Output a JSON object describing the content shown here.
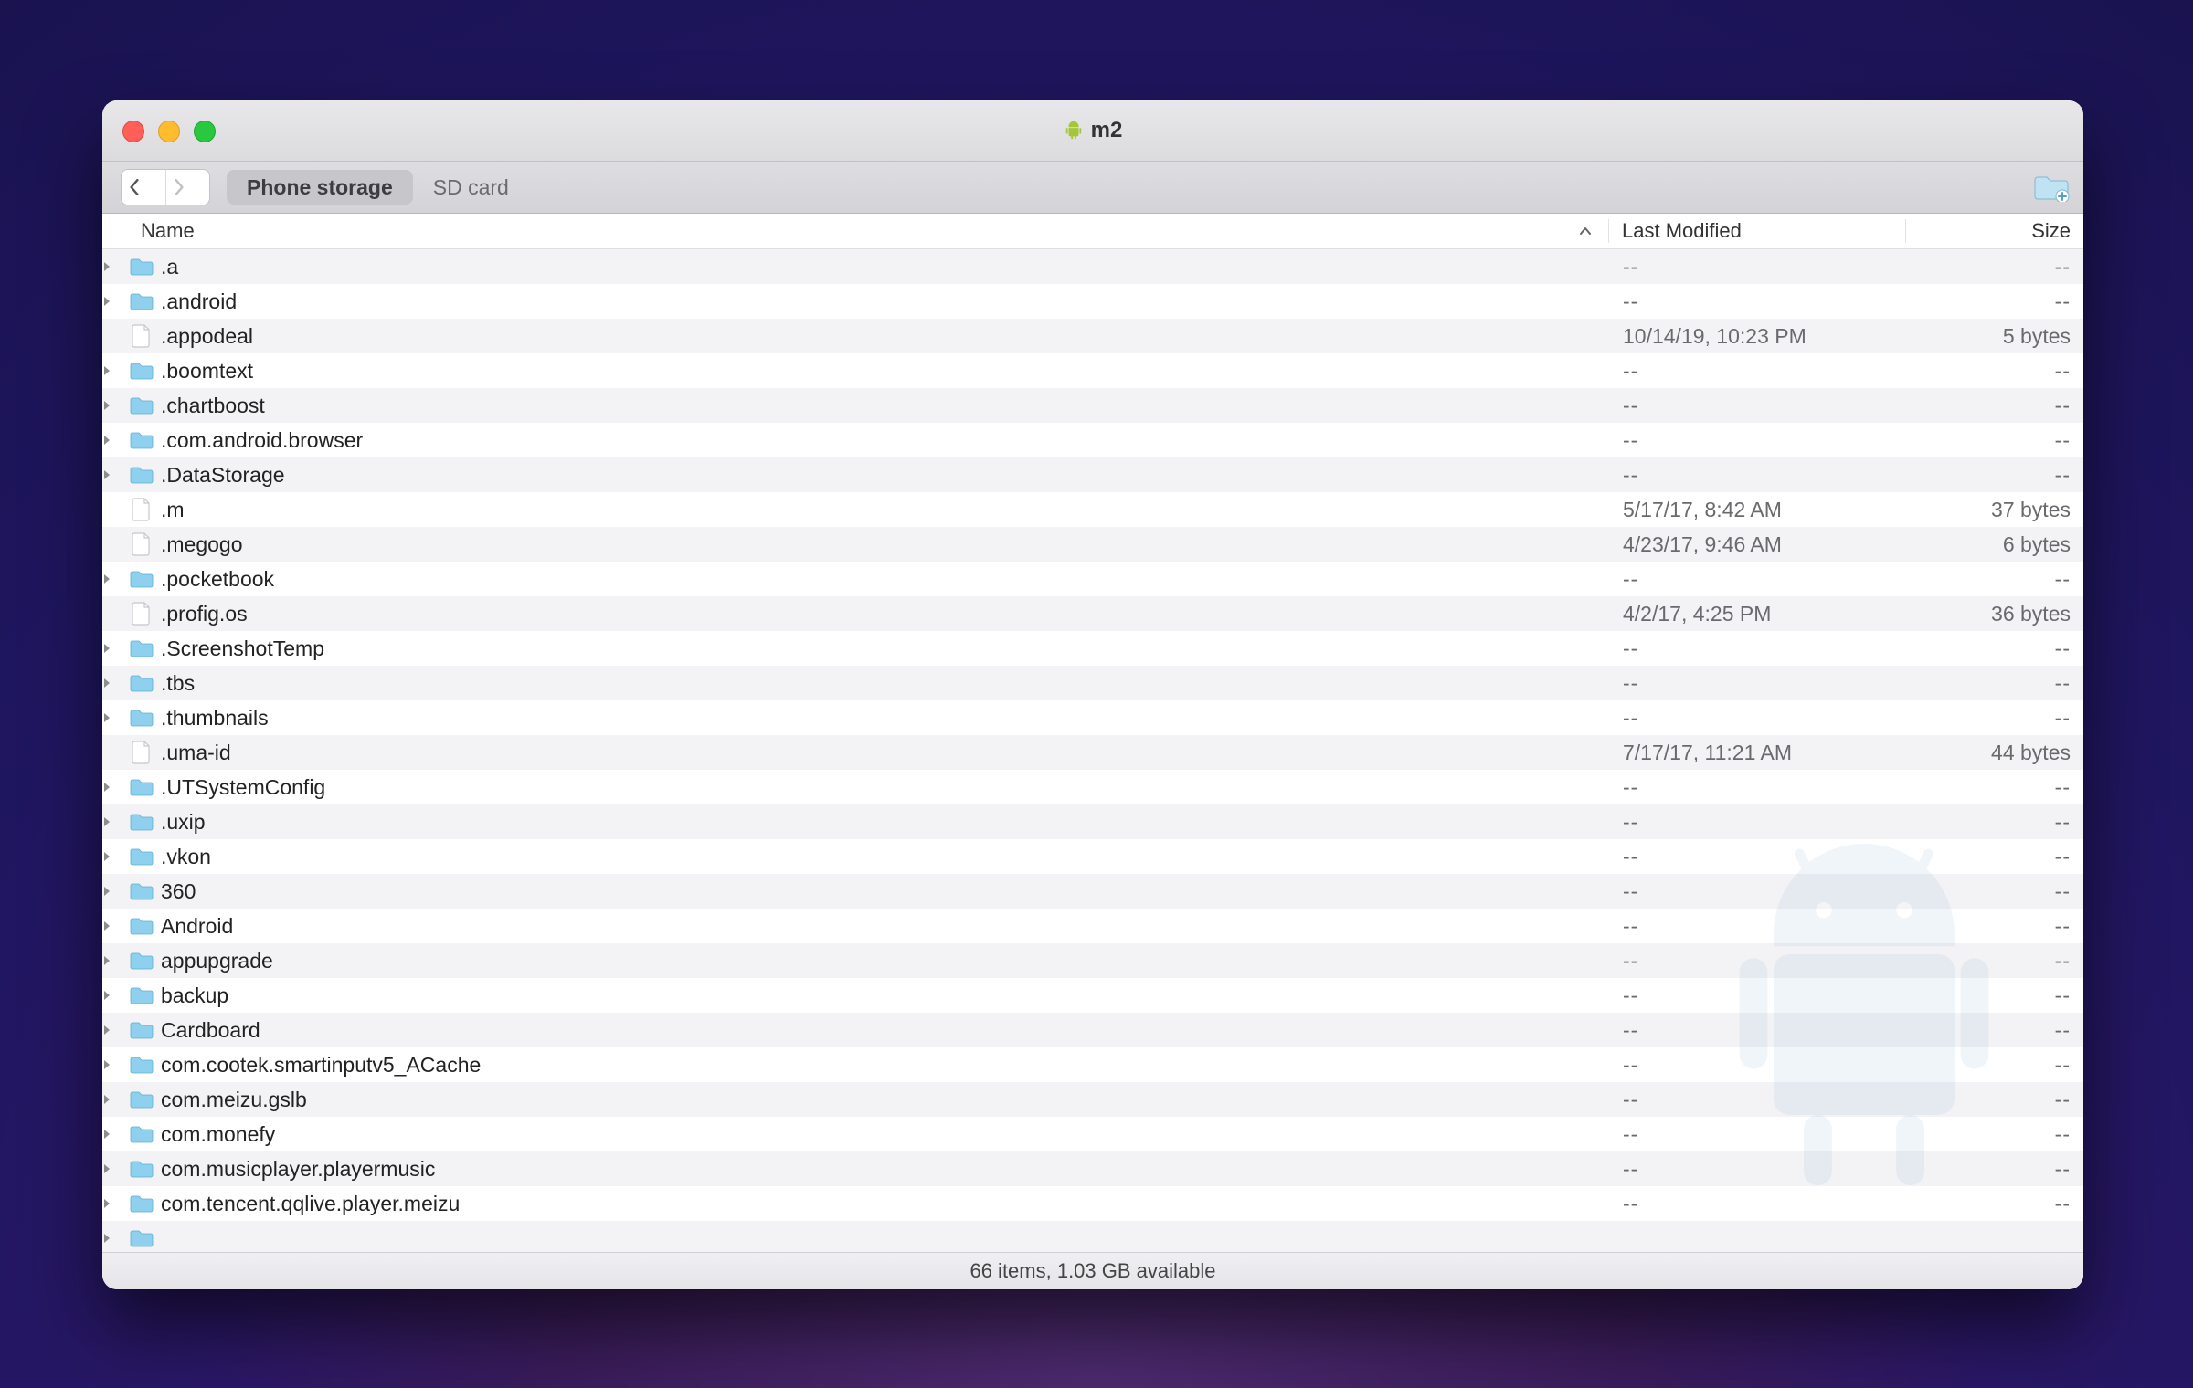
{
  "window": {
    "title": "m2"
  },
  "toolbar": {
    "tabs": [
      {
        "label": "Phone storage",
        "active": true
      },
      {
        "label": "SD card",
        "active": false
      }
    ]
  },
  "columns": {
    "name": "Name",
    "modified": "Last Modified",
    "size": "Size"
  },
  "status": "66 items, 1.03 GB available",
  "files": [
    {
      "name": ".a",
      "type": "folder",
      "mod": "--",
      "size": "--",
      "disc": true
    },
    {
      "name": ".android",
      "type": "folder",
      "mod": "--",
      "size": "--",
      "disc": true
    },
    {
      "name": ".appodeal",
      "type": "file",
      "mod": "10/14/19, 10:23 PM",
      "size": "5 bytes",
      "disc": false
    },
    {
      "name": ".boomtext",
      "type": "folder",
      "mod": "--",
      "size": "--",
      "disc": true
    },
    {
      "name": ".chartboost",
      "type": "folder",
      "mod": "--",
      "size": "--",
      "disc": true
    },
    {
      "name": ".com.android.browser",
      "type": "folder",
      "mod": "--",
      "size": "--",
      "disc": true
    },
    {
      "name": ".DataStorage",
      "type": "folder",
      "mod": "--",
      "size": "--",
      "disc": true
    },
    {
      "name": ".m",
      "type": "file",
      "mod": "5/17/17, 8:42 AM",
      "size": "37 bytes",
      "disc": false
    },
    {
      "name": ".megogo",
      "type": "file",
      "mod": "4/23/17, 9:46 AM",
      "size": "6 bytes",
      "disc": false
    },
    {
      "name": ".pocketbook",
      "type": "folder",
      "mod": "--",
      "size": "--",
      "disc": true
    },
    {
      "name": ".profig.os",
      "type": "file",
      "mod": "4/2/17, 4:25 PM",
      "size": "36 bytes",
      "disc": false
    },
    {
      "name": ".ScreenshotTemp",
      "type": "folder",
      "mod": "--",
      "size": "--",
      "disc": true
    },
    {
      "name": ".tbs",
      "type": "folder",
      "mod": "--",
      "size": "--",
      "disc": true
    },
    {
      "name": ".thumbnails",
      "type": "folder",
      "mod": "--",
      "size": "--",
      "disc": true
    },
    {
      "name": ".uma-id",
      "type": "file",
      "mod": "7/17/17, 11:21 AM",
      "size": "44 bytes",
      "disc": false
    },
    {
      "name": ".UTSystemConfig",
      "type": "folder",
      "mod": "--",
      "size": "--",
      "disc": true
    },
    {
      "name": ".uxip",
      "type": "folder",
      "mod": "--",
      "size": "--",
      "disc": true
    },
    {
      "name": ".vkon",
      "type": "folder",
      "mod": "--",
      "size": "--",
      "disc": true
    },
    {
      "name": "360",
      "type": "folder",
      "mod": "--",
      "size": "--",
      "disc": true
    },
    {
      "name": "Android",
      "type": "folder",
      "mod": "--",
      "size": "--",
      "disc": true
    },
    {
      "name": "appupgrade",
      "type": "folder",
      "mod": "--",
      "size": "--",
      "disc": true
    },
    {
      "name": "backup",
      "type": "folder",
      "mod": "--",
      "size": "--",
      "disc": true
    },
    {
      "name": "Cardboard",
      "type": "folder",
      "mod": "--",
      "size": "--",
      "disc": true
    },
    {
      "name": "com.cootek.smartinputv5_ACache",
      "type": "folder",
      "mod": "--",
      "size": "--",
      "disc": true
    },
    {
      "name": "com.meizu.gslb",
      "type": "folder",
      "mod": "--",
      "size": "--",
      "disc": true
    },
    {
      "name": "com.monefy",
      "type": "folder",
      "mod": "--",
      "size": "--",
      "disc": true
    },
    {
      "name": "com.musicplayer.playermusic",
      "type": "folder",
      "mod": "--",
      "size": "--",
      "disc": true
    },
    {
      "name": "com.tencent.qqlive.player.meizu",
      "type": "folder",
      "mod": "--",
      "size": "--",
      "disc": true
    },
    {
      "name": "",
      "type": "folder",
      "mod": "",
      "size": "",
      "disc": true
    }
  ]
}
